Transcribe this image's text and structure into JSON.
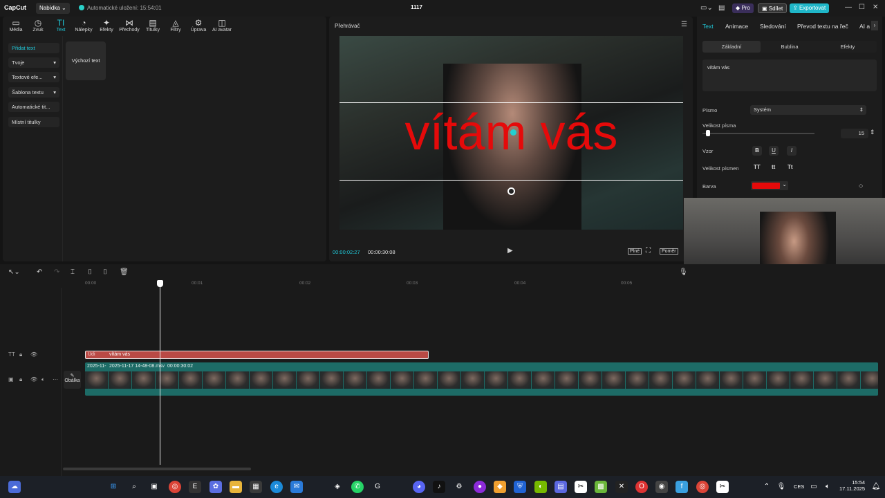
{
  "app": {
    "logo": "CapCut",
    "menu_label": "Nabídka",
    "autosave": "Automatické uložení: 15:54:01",
    "project_name": "1117",
    "pro_label": "Pro",
    "share_label": "Sdílet",
    "export_label": "Exportovat"
  },
  "tools": [
    {
      "icon": "▭",
      "label": "Média"
    },
    {
      "icon": "◷",
      "label": "Zvuk"
    },
    {
      "icon": "TI",
      "label": "Text"
    },
    {
      "icon": "◔",
      "label": "Nálepky"
    },
    {
      "icon": "✦",
      "label": "Efekty"
    },
    {
      "icon": "⋈",
      "label": "Přechody"
    },
    {
      "icon": "▤",
      "label": "Titulky"
    },
    {
      "icon": "◬",
      "label": "Filtry"
    },
    {
      "icon": "⚙",
      "label": "Úprava"
    },
    {
      "icon": "◫",
      "label": "AI avatar"
    }
  ],
  "sidebar": [
    "Přidat text",
    "Tvoje",
    "Textové efe...",
    "Šablona textu",
    "Automatické tit...",
    "Místní titulky"
  ],
  "default_text_card": "Výchozí text",
  "player": {
    "title": "Přehrávač",
    "overlay_text": "vítám vás",
    "current_time": "00:00:02:27",
    "total_time": "00:00:30:08",
    "full_label": "Plné",
    "ratio_label": "Poměr"
  },
  "right_panel": {
    "tabs": [
      "Text",
      "Animace",
      "Sledování",
      "Převod textu na řeč",
      "AI a"
    ],
    "subtabs": [
      "Základní",
      "Bublina",
      "Efekty"
    ],
    "text_value": "vítám vás",
    "font_label": "Písmo",
    "font_value": "Systém",
    "size_label": "Velikost písma",
    "size_value": "15",
    "style_label": "Vzor",
    "style_buttons": [
      "B",
      "U",
      "I"
    ],
    "case_label": "Velikost písmen",
    "case_buttons": [
      "TT",
      "tt",
      "Tt"
    ],
    "color_label": "Barva",
    "color_value": "#e50a0a"
  },
  "timeline": {
    "ruler": [
      "00:00",
      "00:01",
      "00:02",
      "00:03",
      "00:04",
      "00:05"
    ],
    "text_clip_prefix": "Udi",
    "text_clip_label": "vítám vás",
    "video_clip_prefix": "2025-11-",
    "video_clip_name": "2025-11-17 14-48-08.mkv",
    "video_clip_duration": "00:00:30:02",
    "cover_label": "Obálka"
  },
  "taskbar": {
    "lang": "CES",
    "time": "15:54",
    "date": "17.11.2025"
  }
}
